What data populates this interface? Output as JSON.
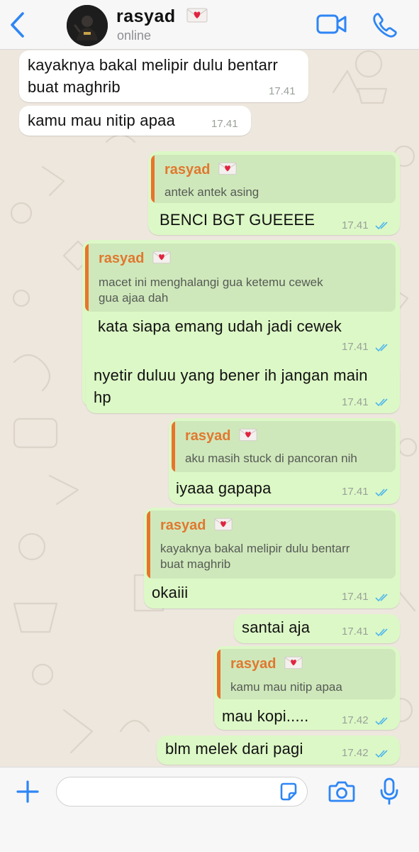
{
  "header": {
    "contact_name": "rasyad",
    "contact_status": "online"
  },
  "colors": {
    "accent": "#2e86f5",
    "incoming_bubble": "#ffffff",
    "outgoing_bubble": "#dcf8c6",
    "quote_bar": "#e8742a",
    "quote_name": "#e0782f",
    "read_ticks": "#4fb6ec"
  },
  "icons": {
    "back": "chevron-left-icon",
    "video": "video-camera-icon",
    "call": "phone-icon",
    "heart_envelope": "love-letter-emoji",
    "plus": "plus-icon",
    "sticker": "sticker-icon",
    "camera": "camera-icon",
    "mic": "microphone-icon"
  },
  "messages": [
    {
      "direction": "incoming",
      "lines": [
        "kayaknya bakal melipir dulu bentarr",
        "buat maghrib"
      ],
      "time": "17.41"
    },
    {
      "direction": "incoming",
      "lines": [
        "kamu mau nitip apaa"
      ],
      "time": "17.41"
    },
    {
      "direction": "outgoing",
      "quote": {
        "author": "rasyad",
        "lines": [
          "antek antek asing"
        ]
      },
      "lines": [
        "BENCI BGT GUEEEE"
      ],
      "time": "17.41",
      "status": "read"
    },
    {
      "direction": "outgoing",
      "quote": {
        "author": "rasyad",
        "lines": [
          "macet ini menghalangi gua ketemu cewek",
          "gua ajaa dah"
        ]
      },
      "lines": [
        "kata siapa emang udah jadi cewek"
      ],
      "time": "17.41",
      "status": "read"
    },
    {
      "direction": "outgoing",
      "lines": [
        "nyetir duluu yang bener ih jangan main",
        "hp"
      ],
      "time": "17.41",
      "status": "read"
    },
    {
      "direction": "outgoing",
      "quote": {
        "author": "rasyad",
        "lines": [
          "aku masih stuck di pancoran nih"
        ]
      },
      "lines": [
        "iyaaa gapapa"
      ],
      "time": "17.41",
      "status": "read"
    },
    {
      "direction": "outgoing",
      "quote": {
        "author": "rasyad",
        "lines": [
          "kayaknya bakal melipir dulu bentarr",
          "buat maghrib"
        ]
      },
      "lines": [
        "okaiii"
      ],
      "time": "17.41",
      "status": "read"
    },
    {
      "direction": "outgoing",
      "lines": [
        "santai aja"
      ],
      "time": "17.41",
      "status": "read"
    },
    {
      "direction": "outgoing",
      "quote": {
        "author": "rasyad",
        "lines": [
          "kamu mau nitip apaa"
        ]
      },
      "lines": [
        "mau kopi....."
      ],
      "time": "17.42",
      "status": "read"
    },
    {
      "direction": "outgoing",
      "lines": [
        "blm melek dari pagi"
      ],
      "time": "17.42",
      "status": "read"
    }
  ],
  "composer": {
    "value": "",
    "placeholder": ""
  }
}
